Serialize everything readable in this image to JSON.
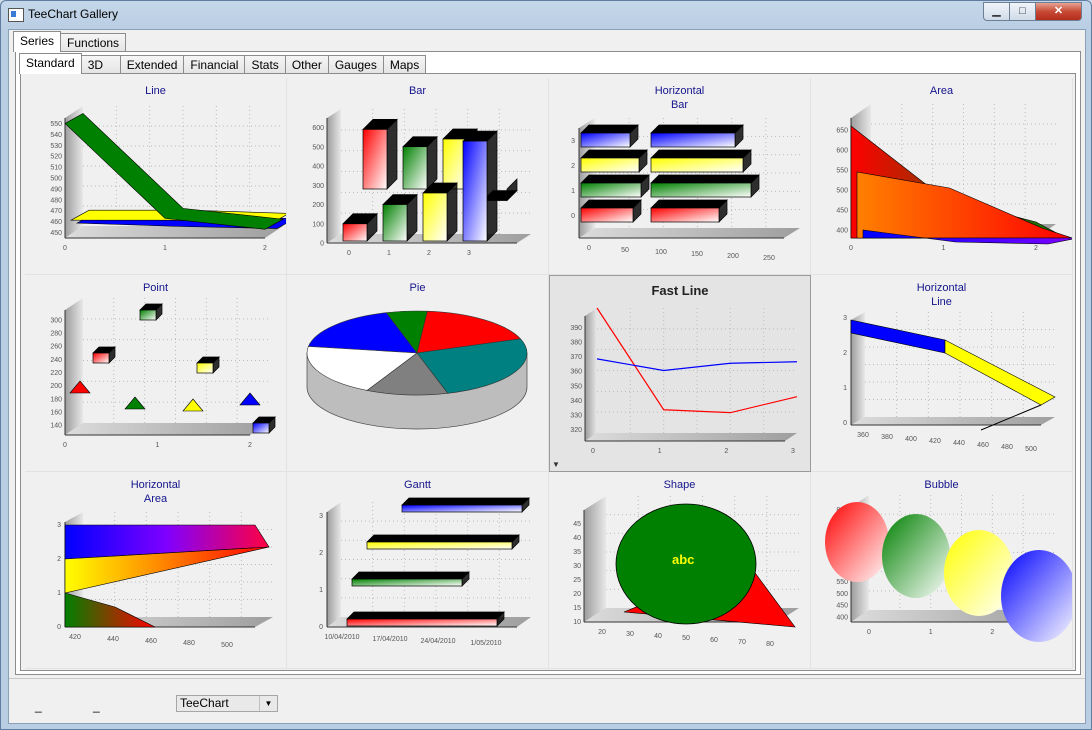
{
  "window": {
    "title": "TeeChart Gallery",
    "min_symbol": "▁",
    "max_symbol": "□",
    "close_symbol": "✕"
  },
  "tabs_top": [
    {
      "label": "Series",
      "active": true
    },
    {
      "label": "Functions",
      "active": false
    }
  ],
  "tabs_sub": [
    {
      "label": "Standard",
      "active": true
    },
    {
      "label": "3D",
      "active": false
    },
    {
      "label": "Extended",
      "active": false
    },
    {
      "label": "Financial",
      "active": false
    },
    {
      "label": "Stats",
      "active": false
    },
    {
      "label": "Other",
      "active": false
    },
    {
      "label": "Gauges",
      "active": false
    },
    {
      "label": "Maps",
      "active": false
    }
  ],
  "gallery": [
    {
      "title": "Line"
    },
    {
      "title": "Bar"
    },
    {
      "title": "Horizontal\nBar"
    },
    {
      "title": "Area"
    },
    {
      "title": "Point"
    },
    {
      "title": "Pie"
    },
    {
      "title": "Fast Line"
    },
    {
      "title": "Horizontal\nLine"
    },
    {
      "title": "Horizontal\nArea"
    },
    {
      "title": "Gantt"
    },
    {
      "title": "Shape"
    },
    {
      "title": "Bubble"
    }
  ],
  "selected_chart": "Fast Line",
  "chart_data": [
    {
      "type": "line",
      "title": "Line",
      "x": [
        0,
        1,
        2
      ],
      "yticks": [
        450,
        460,
        470,
        480,
        490,
        500,
        510,
        520,
        530,
        540,
        550
      ],
      "ylim": [
        445,
        555
      ],
      "series": [
        {
          "values": [
            550,
            463,
            453
          ],
          "color": "#008000"
        },
        {
          "values": [
            465,
            465,
            462
          ],
          "color": "#ffff00"
        },
        {
          "values": [
            466,
            463,
            461
          ],
          "color": "#0000ff"
        }
      ]
    },
    {
      "type": "bar",
      "title": "Bar",
      "categories": [
        "0",
        "1",
        "2",
        "3"
      ],
      "yticks": [
        0,
        100,
        200,
        300,
        400,
        500,
        600
      ],
      "ylim": [
        0,
        650
      ],
      "series": [
        {
          "values": [
            570,
            480,
            520,
            200
          ],
          "color": "#ff0000"
        },
        {
          "values": [
            170,
            430,
            590,
            580
          ],
          "color": "#008000"
        },
        {
          "values": [
            100,
            200,
            260,
            530
          ],
          "color": "#ffff00"
        }
      ]
    },
    {
      "type": "bar",
      "title": "Horizontal Bar",
      "categories": [
        "0",
        "1",
        "2",
        "3"
      ],
      "xticks": [
        0,
        50,
        100,
        150,
        200,
        250
      ],
      "xlim": [
        0,
        250
      ],
      "series": [
        {
          "values": [
            40,
            225,
            60,
            30
          ],
          "color": "#ff0000"
        },
        {
          "values": [
            70,
            100,
            110,
            70
          ],
          "color": "#008000"
        },
        {
          "values": [
            80,
            110,
            120,
            120
          ],
          "color": "#ffff00"
        },
        {
          "values": [
            120,
            200,
            180,
            160
          ],
          "color": "#0000ff"
        }
      ]
    },
    {
      "type": "area",
      "title": "Area",
      "x": [
        0,
        1,
        2
      ],
      "yticks": [
        400,
        450,
        500,
        550,
        600,
        650
      ],
      "ylim": [
        380,
        680
      ],
      "series": [
        {
          "values": [
            660,
            480,
            420
          ],
          "color": "#008000"
        },
        {
          "values": [
            560,
            520,
            420
          ],
          "color": "#ff8000"
        },
        {
          "values": [
            430,
            400,
            395
          ],
          "color": "#0000ff"
        }
      ]
    },
    {
      "type": "scatter",
      "title": "Point",
      "x": [
        0,
        1,
        2
      ],
      "yticks": [
        140,
        160,
        180,
        200,
        220,
        240,
        260,
        280,
        300
      ],
      "ylim": [
        125,
        315
      ],
      "series": [
        {
          "name": "",
          "points": [
            [
              0.3,
              240
            ],
            [
              0.1,
              220
            ],
            [
              1.1,
              175
            ],
            [
              1.6,
              180
            ],
            [
              1.5,
              300
            ]
          ],
          "color": "#ff0000"
        }
      ]
    },
    {
      "type": "pie",
      "title": "Pie",
      "values": [
        18,
        6,
        18,
        26,
        12,
        20
      ],
      "colors": [
        "#0000ff",
        "#008000",
        "#ff0000",
        "#008080",
        "#808080",
        "#ffffff"
      ]
    },
    {
      "type": "line",
      "title": "Fast Line",
      "x": [
        0,
        1,
        2,
        3
      ],
      "yticks": [
        320,
        330,
        340,
        350,
        360,
        370,
        380,
        390
      ],
      "ylim": [
        312,
        398
      ],
      "series": [
        {
          "values": [
            398,
            328,
            326,
            337
          ],
          "color": "#ff0000"
        },
        {
          "values": [
            363,
            355,
            360,
            361
          ],
          "color": "#0000ff"
        }
      ]
    },
    {
      "type": "line",
      "title": "Horizontal Line",
      "xticks": [
        360,
        380,
        400,
        420,
        440,
        460,
        480,
        500
      ],
      "yticks": [
        0,
        1,
        2,
        3
      ],
      "xlim": [
        350,
        510
      ],
      "series": [
        {
          "values": [
            360,
            420,
            480,
            500
          ],
          "color": "#0000ff"
        }
      ]
    },
    {
      "type": "area",
      "title": "Horizontal Area",
      "xticks": [
        420,
        440,
        460,
        480,
        500
      ],
      "yticks": [
        0,
        1,
        2,
        3
      ],
      "xlim": [
        410,
        510
      ],
      "series": [
        {
          "values": [
            450,
            500,
            500,
            510
          ],
          "color": "#0000ff"
        }
      ]
    },
    {
      "type": "bar",
      "title": "Gantt",
      "xticks": [
        "10/04/2010",
        "17/04/2010",
        "24/04/2010",
        "1/05/2010"
      ],
      "yticks": [
        0,
        1,
        2,
        3
      ],
      "series": [
        {
          "start": [
            0,
            1,
            2,
            3
          ],
          "end": [
            3,
            3,
            3,
            3
          ]
        }
      ]
    },
    {
      "type": "scatter",
      "title": "Shape",
      "xticks": [
        20,
        30,
        40,
        50,
        60,
        70,
        80
      ],
      "yticks": [
        10,
        15,
        20,
        25,
        30,
        35,
        40,
        45
      ],
      "label": "abc"
    },
    {
      "type": "scatter",
      "title": "Bubble",
      "x": [
        0,
        1,
        2,
        3
      ],
      "yticks": [
        400,
        450,
        500,
        550,
        600,
        650,
        700,
        750,
        800,
        850
      ],
      "ylim": [
        380,
        860
      ],
      "series": [
        {
          "name": "",
          "points": [
            [
              0,
              700
            ],
            [
              1,
              650
            ],
            [
              2,
              620
            ],
            [
              3,
              580
            ]
          ],
          "color": "#ff0000"
        }
      ]
    }
  ],
  "bottom": {
    "dash_1": "_",
    "dash_2": "_",
    "theme_select": "TeeChart",
    "theme_arrow": "▼"
  },
  "fast_line_marker": "▼"
}
